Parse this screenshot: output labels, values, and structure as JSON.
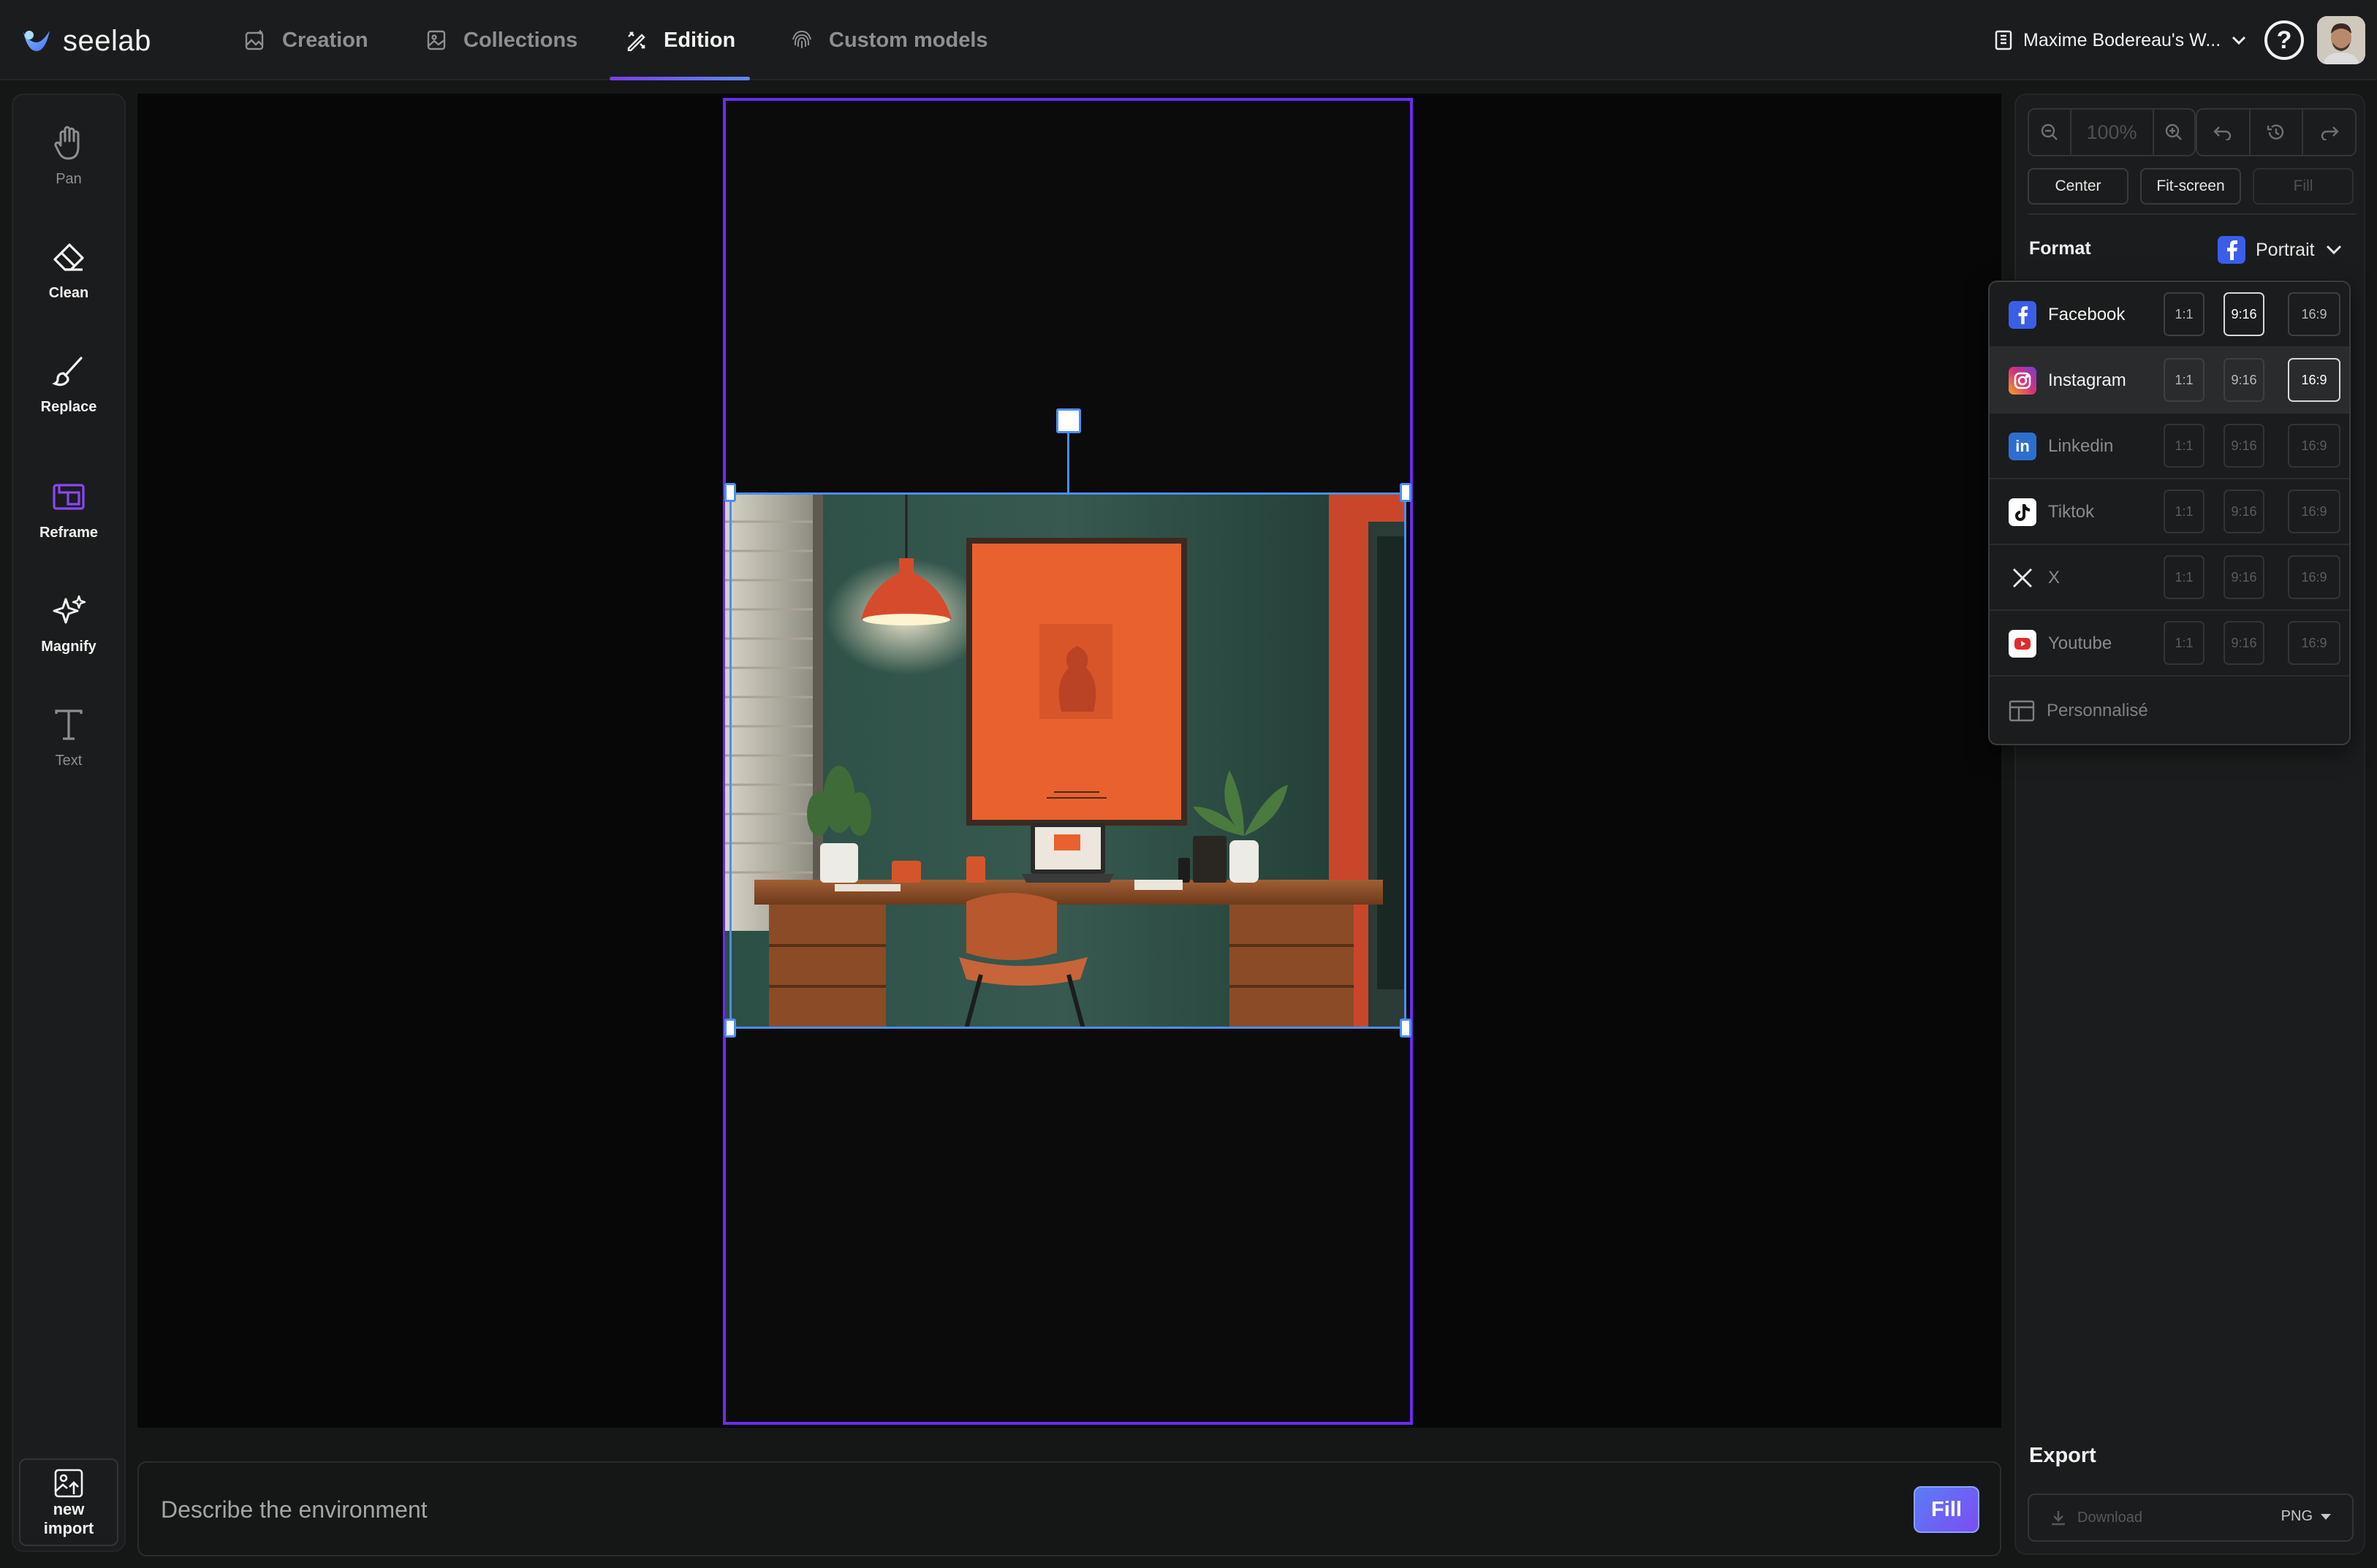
{
  "app": {
    "name": "seelab"
  },
  "nav": {
    "tabs": [
      {
        "label": "Creation",
        "icon": "image-sparkle-icon"
      },
      {
        "label": "Collections",
        "icon": "image-stack-icon"
      },
      {
        "label": "Edition",
        "icon": "edit-tools-icon",
        "active": true
      },
      {
        "label": "Custom models",
        "icon": "fingerprint-icon"
      }
    ],
    "workspace": "Maxime Bodereau's W..."
  },
  "tools": [
    {
      "label": "Pan",
      "icon": "hand-icon"
    },
    {
      "label": "Clean",
      "icon": "eraser-icon"
    },
    {
      "label": "Replace",
      "icon": "brush-icon"
    },
    {
      "label": "Reframe",
      "icon": "reframe-icon",
      "active": true
    },
    {
      "label": "Magnify",
      "icon": "sparkles-icon"
    },
    {
      "label": "Text",
      "icon": "text-icon"
    }
  ],
  "new_import": {
    "line1": "new",
    "line2": "import"
  },
  "prompt": {
    "placeholder": "Describe the environment",
    "button": "Fill"
  },
  "right_panel": {
    "zoom_value": "100%",
    "view_buttons": [
      "Center",
      "Fit-screen",
      "Fill"
    ],
    "format_label": "Format",
    "format_value": "Portrait",
    "export_label": "Export",
    "download_label": "Download",
    "file_type": "PNG"
  },
  "format_dropdown": {
    "ratios": [
      "1:1",
      "9:16",
      "16:9"
    ],
    "platforms": [
      {
        "name": "Facebook",
        "icon": "facebook-icon",
        "color": "#3b5ee8",
        "selected_ratio": "9:16"
      },
      {
        "name": "Instagram",
        "icon": "instagram-icon",
        "color": "#d6317a",
        "selected_ratio": "16:9"
      },
      {
        "name": "Linkedin",
        "icon": "linkedin-icon",
        "color": "#2d6fd1",
        "selected_ratio": null
      },
      {
        "name": "Tiktok",
        "icon": "tiktok-icon",
        "color": "#ffffff",
        "selected_ratio": null
      },
      {
        "name": "X",
        "icon": "x-icon",
        "color": "#ffffff",
        "selected_ratio": null
      },
      {
        "name": "Youtube",
        "icon": "youtube-icon",
        "color": "#e02b2b",
        "selected_ratio": null
      }
    ],
    "custom_label": "Personnalisé"
  },
  "colors": {
    "accent": "#6a2cf0",
    "selection": "#4c8ff2",
    "background": "#151616",
    "panel": "#1b1c1d"
  }
}
